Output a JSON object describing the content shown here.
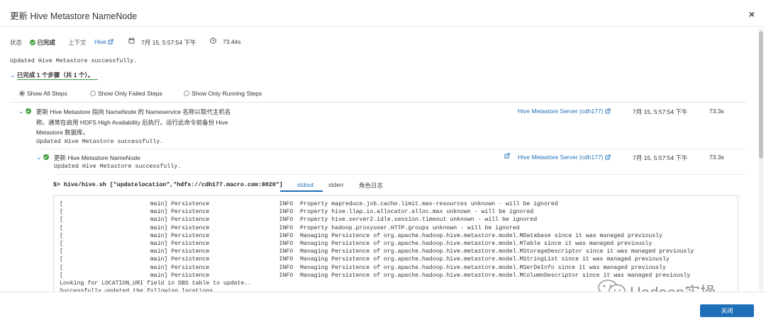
{
  "dialog": {
    "title": "更新 Hive Metastore NameNode",
    "close_symbol": "×"
  },
  "status": {
    "status_label": "状态",
    "status_value": "已完成",
    "context_label": "上下文",
    "context_value": "Hive",
    "timestamp": "7月 15, 5:57:54 下午",
    "duration": "73.44s",
    "message": "Updated Hive Metastore successfully."
  },
  "summary": {
    "text": "已完成 1 个步骤（共 1 个）。"
  },
  "filters": {
    "all": "Show All Steps",
    "failed": "Show Only Failed Steps",
    "running": "Show Only Running Steps"
  },
  "step1": {
    "desc_line1": "更新 Hive Metastore 指向 NameNode 的 Nameservice 名称以取代主机名",
    "desc_line2": "称。通常在启用 HDFS High Availability 后执行。运行此命令前备份 Hive",
    "desc_line3": "Metastore 数据库。",
    "message": "Updated Hive Metastore successfully.",
    "server": "Hive Metastore Server (cdh177)",
    "time": "7月 15, 5:57:54 下午",
    "duration": "73.3s"
  },
  "step2": {
    "name": "更新 Hive Metastore NameNode",
    "message": "Updated Hive Metastore successfully.",
    "server": "Hive Metastore Server (cdh177)",
    "time": "7月 15, 5:57:54 下午",
    "duration": "73.3s"
  },
  "command": {
    "text": "$> hive/hive.sh [\"updatelocation\",\"hdfs://cdh177.macro.com:8020\"]"
  },
  "tabs": [
    "stdout",
    "stderr",
    "角色日志"
  ],
  "log_lines": [
    "[                         main] Persistence                    INFO  Property mapreduce.job.cache.limit.max-resources unknown - will be ignored",
    "[                         main] Persistence                    INFO  Property hive.llap.io.allocator.alloc.max unknown - will be ignored",
    "[                         main] Persistence                    INFO  Property hive.server2.idle.session.timeout unknown - will be ignored",
    "[                         main] Persistence                    INFO  Property hadoop.proxyuser.HTTP.groups unknown - will be ignored",
    "[                         main] Persistence                    INFO  Managing Persistence of org.apache.hadoop.hive.metastore.model.MDatabase since it was managed previously",
    "[                         main] Persistence                    INFO  Managing Persistence of org.apache.hadoop.hive.metastore.model.MTable since it was managed previously",
    "[                         main] Persistence                    INFO  Managing Persistence of org.apache.hadoop.hive.metastore.model.MStorageDescriptor since it was managed previously",
    "[                         main] Persistence                    INFO  Managing Persistence of org.apache.hadoop.hive.metastore.model.MStringList since it was managed previously",
    "[                         main] Persistence                    INFO  Managing Persistence of org.apache.hadoop.hive.metastore.model.MSerDeInfo since it was managed previously",
    "[                         main] Persistence                    INFO  Managing Persistence of org.apache.hadoop.hive.metastore.model.MColumnDescriptor since it was managed previously",
    "Looking for LOCATION_URI field in DBS table to update..",
    "Successfully updated the following locations.."
  ],
  "footer": {
    "close_button": "关闭",
    "watermark": "Hadoop实操"
  },
  "icons": {
    "external_link": "external-link-icon",
    "calendar": "calendar-icon",
    "clock": "clock-icon",
    "check": "check-circle-icon",
    "chevron": "chevron-down-icon"
  },
  "colors": {
    "accent": "#1e6fb8",
    "success": "#3a9c3a"
  }
}
